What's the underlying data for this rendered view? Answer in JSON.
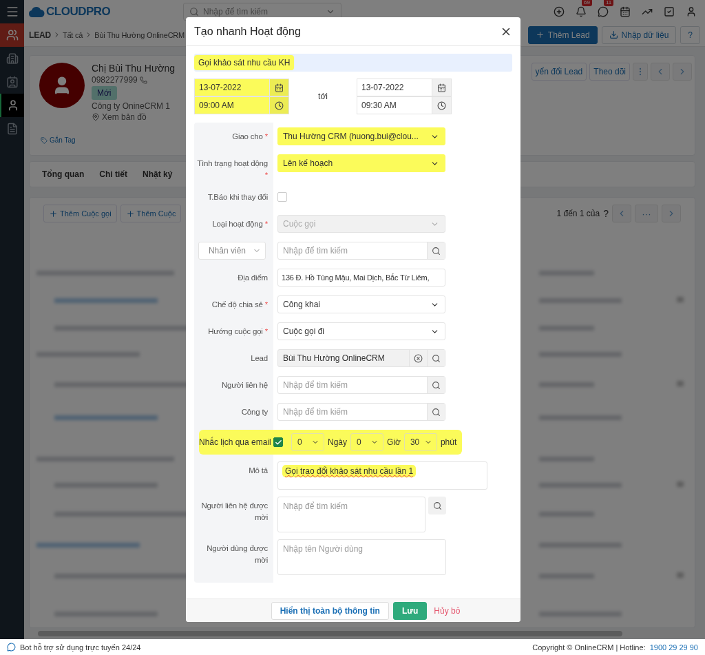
{
  "topbar": {
    "logo": "CLOUDPRO",
    "search_placeholder": "Nhập để tìm kiếm",
    "icons": [
      {
        "kind": "add"
      },
      {
        "kind": "bell",
        "count": "69"
      },
      {
        "kind": "chat",
        "count": "11"
      },
      {
        "kind": "calendar"
      },
      {
        "kind": "chart"
      },
      {
        "kind": "tasks"
      },
      {
        "kind": "user"
      }
    ]
  },
  "sidebar": {
    "items": [
      {
        "kind": "module",
        "selected": false
      },
      {
        "kind": "building",
        "selected": false
      },
      {
        "kind": "contact",
        "selected": false
      },
      {
        "kind": "person",
        "selected": true
      },
      {
        "kind": "document",
        "selected": false
      }
    ]
  },
  "breadcrumb": [
    "LEAD",
    "Tất cả",
    "Bùi Thu Hường OnlineCRM"
  ],
  "header_buttons": [
    {
      "kind": "primary",
      "label": "Thêm Lead"
    },
    {
      "kind": "import",
      "label": "Nhập dữ liệu"
    },
    {
      "kind": "help",
      "label": "?"
    }
  ],
  "profile": {
    "name": "Chị Bùi Thu Hường",
    "phone": "0982277999",
    "status": "Mới",
    "company": "Công ty OnineCRM 1",
    "map_link": "Xem bản đồ",
    "tag_link": "Gắn Tag",
    "actions": [
      "yển đổi Lead",
      "Theo dõi"
    ]
  },
  "tabs": [
    {
      "label": "Tổng quan",
      "selected": false
    },
    {
      "label": "Chi tiết",
      "selected": false
    },
    {
      "label": "Nhật ký",
      "selected": false
    }
  ],
  "activity": {
    "buttons": [
      "Thêm Cuộc gọi",
      "Thêm Cuộc"
    ],
    "pagination": "1 đến 1 của",
    "help": "?",
    "more": "···"
  },
  "footer": {
    "bot": "Bot hỗ trợ sử dụng trực tuyến 24/24",
    "copyright": "Copyright © OnlineCRM | Hotline:",
    "hotline": "1900 29 29 90"
  },
  "modal": {
    "title": "Tạo nhanh Hoạt động",
    "subject": {
      "value": "Gọi khảo sát nhu cầu KH",
      "highlighted": true
    },
    "start": {
      "date": "13-07-2022",
      "time": "09:00 AM",
      "highlighted": true
    },
    "to_label": "tới",
    "end": {
      "date": "13-07-2022",
      "time": "09:30 AM",
      "highlighted": false
    },
    "fields": [
      {
        "kind": "select",
        "label": "Giao cho",
        "required_mark": "*",
        "value": "Thu Hường CRM (huong.bui@clou...",
        "highlighted": true,
        "disabled": false
      },
      {
        "kind": "select",
        "label": "Tình trạng hoạt động",
        "required_mark": "*",
        "value": "Lên kế hoạch",
        "highlighted": true,
        "disabled": false
      },
      {
        "kind": "checkbox",
        "label": "T.Báo khi thay đổi",
        "checked": false
      },
      {
        "kind": "select",
        "label": "Loại hoạt động",
        "required_mark": "*",
        "value": "Cuộc gọi",
        "highlighted": false,
        "disabled": true
      },
      {
        "kind": "picker_search",
        "picker": "Nhân viên",
        "placeholder": "Nhập để tìm kiếm"
      },
      {
        "kind": "text",
        "label": "Địa điểm",
        "value": "136 Đ. Hồ Tùng Mậu, Mai Dịch, Bắc Từ Liêm,"
      },
      {
        "kind": "select",
        "label": "Chế độ chia sẻ",
        "required_mark": "*",
        "value": "Công khai",
        "highlighted": false,
        "disabled": false
      },
      {
        "kind": "select",
        "label": "Hướng cuộc gọi",
        "required_mark": "*",
        "value": "Cuộc gọi đi",
        "highlighted": false,
        "disabled": false
      },
      {
        "kind": "lookup",
        "label": "Lead",
        "value": "Bùi Thu Hường OnlineCRM"
      },
      {
        "kind": "search",
        "label": "Người liên hệ",
        "placeholder": "Nhập để tìm kiếm"
      },
      {
        "kind": "search",
        "label": "Công ty",
        "placeholder": "Nhập để tìm kiếm"
      },
      {
        "kind": "reminder",
        "label": "Nhắc lịch qua email",
        "checked": true,
        "highlighted": true,
        "days": "0",
        "days_unit": "Ngày",
        "hours": "0",
        "hours_unit": "Giờ",
        "minutes": "30",
        "minutes_unit": "phút"
      },
      {
        "kind": "textarea",
        "label": "Mô tả",
        "value": "Gọi trao đổi khảo sát nhu cầu lần 1",
        "highlighted": true
      },
      {
        "kind": "search_area",
        "label": "Người liên hệ được mời",
        "placeholder": "Nhập để tìm kiếm"
      },
      {
        "kind": "area",
        "label": "Người dùng được mời",
        "placeholder": "Nhập tên Người dùng"
      }
    ],
    "buttons": [
      {
        "kind": "outline",
        "label": "Hiển thị toàn bộ thông tin"
      },
      {
        "kind": "save",
        "label": "Lưu"
      },
      {
        "kind": "cancel",
        "label": "Hủy bỏ"
      }
    ]
  }
}
